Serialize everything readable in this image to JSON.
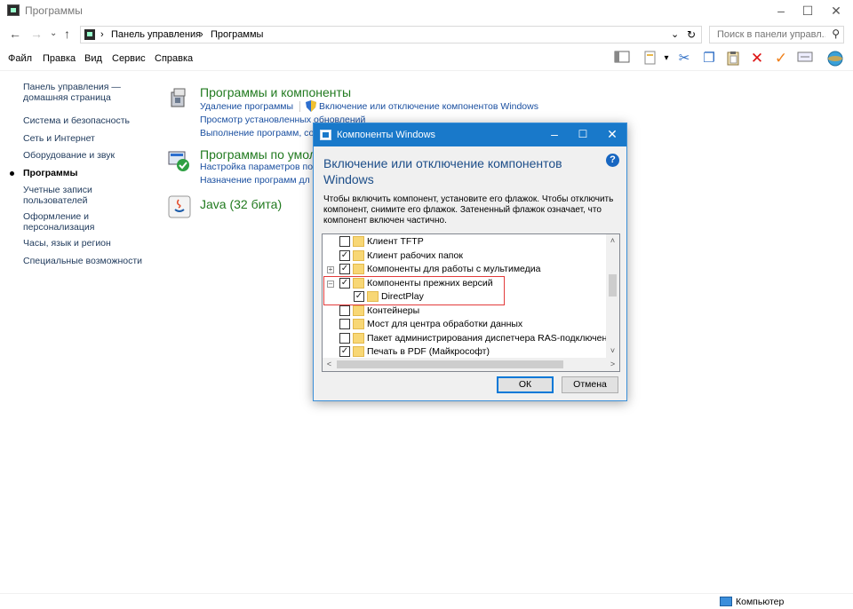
{
  "window": {
    "title": "Программы",
    "minimize": "–",
    "maximize": "☐",
    "close": "✕"
  },
  "address": {
    "back": "←",
    "forward": "→",
    "recent": "⌄",
    "up": "↑",
    "sep1": "›",
    "crumb1": "Панель управления",
    "sep2": "›",
    "crumb2": "Программы",
    "dropdown": "⌄",
    "refresh": "↻",
    "search_placeholder": "Поиск в панели управл...",
    "search_icon": "⚲"
  },
  "menu": {
    "file": "Файл",
    "edit": "Правка",
    "view": "Вид",
    "service": "Сервис",
    "help": "Справка"
  },
  "toolbar": {
    "icons": [
      "panel-icon",
      "properties-icon",
      "cut-icon",
      "copy-icon",
      "paste-icon",
      "delete-icon",
      "check-icon",
      "rename-icon",
      "globe-icon"
    ],
    "cut": "✂",
    "copy": "❐",
    "paste": "📋",
    "delete": "✕",
    "check": "✓",
    "globe": "●",
    "dropdown": "▾"
  },
  "sidebar": {
    "home": "Панель управления — домашняя страница",
    "items": [
      "Система и безопасность",
      "Сеть и Интернет",
      "Оборудование и звук",
      "Программы",
      "Учетные записи пользователей",
      "Оформление и персонализация",
      "Часы, язык и регион",
      "Специальные возможности"
    ]
  },
  "main": {
    "programs_title": "Программы и компоненты",
    "uninstall_link": "Удаление программы",
    "features_link": "Включение или отключение компонентов Windows",
    "updates_link": "Просмотр установленных обновлений",
    "run_old_link": "Выполнение программ, со",
    "defaults_title": "Программы по умол",
    "defaults_link1": "Настройка параметров по у",
    "defaults_link2": "Назначение программ дл",
    "java_title": "Java (32 бита)"
  },
  "dialog": {
    "title": "Компоненты Windows",
    "minimize": "–",
    "maximize": "☐",
    "close": "✕",
    "heading": "Включение или отключение компонентов Windows",
    "help": "?",
    "description": "Чтобы включить компонент, установите его флажок. Чтобы отключить компонент, снимите его флажок. Затененный флажок означает, что компонент включен частично.",
    "tree": [
      {
        "label": "Клиент TFTP",
        "checked": false,
        "expander": ""
      },
      {
        "label": "Клиент рабочих папок",
        "checked": true,
        "expander": ""
      },
      {
        "label": "Компоненты для работы с мультимедиа",
        "checked": true,
        "expander": "+"
      },
      {
        "label": "Компоненты прежних версий",
        "checked": true,
        "expander": "–"
      },
      {
        "label": "DirectPlay",
        "checked": true,
        "expander": "",
        "child": true
      },
      {
        "label": "Контейнеры",
        "checked": false,
        "expander": ""
      },
      {
        "label": "Мост для центра обработки данных",
        "checked": false,
        "expander": ""
      },
      {
        "label": "Пакет администрирования диспетчера RAS-подключений",
        "checked": false,
        "expander": ""
      },
      {
        "label": "Печать в PDF (Майкрософт)",
        "checked": true,
        "expander": ""
      }
    ],
    "checkmark": "✓",
    "scroll_up": "˄",
    "scroll_down": "˅",
    "scroll_left": "<",
    "scroll_right": ">",
    "ok": "ОК",
    "cancel": "Отмена"
  },
  "status": {
    "computer": "Компьютер"
  },
  "colors": {
    "dialog_title_bg": "#1979ca",
    "link": "#1a4fa0",
    "section_title": "#217a1f",
    "highlight": "#e23b3b"
  }
}
